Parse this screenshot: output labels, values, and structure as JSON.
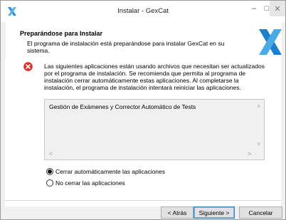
{
  "window": {
    "title": "Instalar - GexCat",
    "minimize_glyph": "–",
    "maximize_glyph": "□",
    "close_glyph": "✕",
    "icon": "gexcat-x-logo-icon"
  },
  "header": {
    "title": "Preparándose para Instalar",
    "subtitle": "El programa de instalación está preparándose para instalar GexCat en su sistema.",
    "logo": "gexcat-x-logo-icon"
  },
  "message": {
    "icon": "error-icon",
    "text": "Las siguientes aplicaciones están usando archivos que necesitan ser actualizados por el programa de instalación. Se recomienda que permita al programa de instalación cerrar automáticamente estas aplicaciones. Al completarse la instalación, el programa de instalación intentará reiniciar las aplicaciones."
  },
  "applications_list": {
    "items": [
      "Gestión de Exámenes y Corrector Automático de Tests"
    ],
    "scroll_up": "˄",
    "scroll_down": "˅",
    "scroll_left": "<",
    "scroll_right": ">"
  },
  "options": {
    "close_auto": {
      "label": "Cerrar automáticamente las aplicaciones",
      "checked": true
    },
    "no_close": {
      "label": "No cerrar las aplicaciones",
      "checked": false
    }
  },
  "buttons": {
    "back": "< Atrás",
    "next": "Siguiente >",
    "cancel": "Cancelar"
  },
  "colors": {
    "accent": "#1e90d6",
    "error": "#d9312b"
  }
}
